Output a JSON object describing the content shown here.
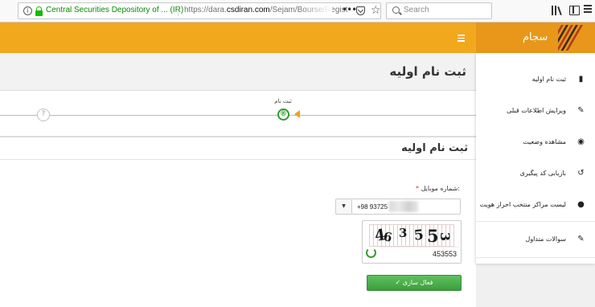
{
  "browser": {
    "identity": "Central Securities Depository of ... (IR)",
    "url_prefix": "https://dara.",
    "url_domain": "csdiran.com",
    "url_suffix": "/Sejam/Bourse/Regist",
    "search_placeholder": "Search"
  },
  "site": {
    "logo_text": "سجام",
    "brand_color": "#f2a81d"
  },
  "page": {
    "title": "ثبت نام اولیه"
  },
  "steps": {
    "current_label": "ثبت نام",
    "current_symbol": "®",
    "next_symbol": "?"
  },
  "form": {
    "title": "ثبت نام اولیه",
    "mobile_label": "شماره موبایل:",
    "required_mark": "*",
    "mobile_value": "+98 93725",
    "country_caret": "▼",
    "captcha_chars": [
      "4",
      "6",
      "3",
      "5",
      "5",
      "3"
    ],
    "captcha_value": "453553",
    "activate_label": "✓ فعال سازی"
  },
  "sidebar": {
    "items": [
      {
        "label": "ثبت نام اولیه",
        "icon": "book-icon"
      },
      {
        "label": "ویرایش اطلاعات قبلی",
        "icon": "edit-icon"
      },
      {
        "label": "مشاهده وضعیت",
        "icon": "eye-icon"
      },
      {
        "label": "بازیابی کد پیگیری",
        "icon": "undo-icon"
      },
      {
        "label": "لیست مراکز منتخب احراز هویت",
        "icon": "user-icon"
      },
      {
        "label": "سوالات متداول",
        "icon": "edit-icon"
      }
    ]
  }
}
